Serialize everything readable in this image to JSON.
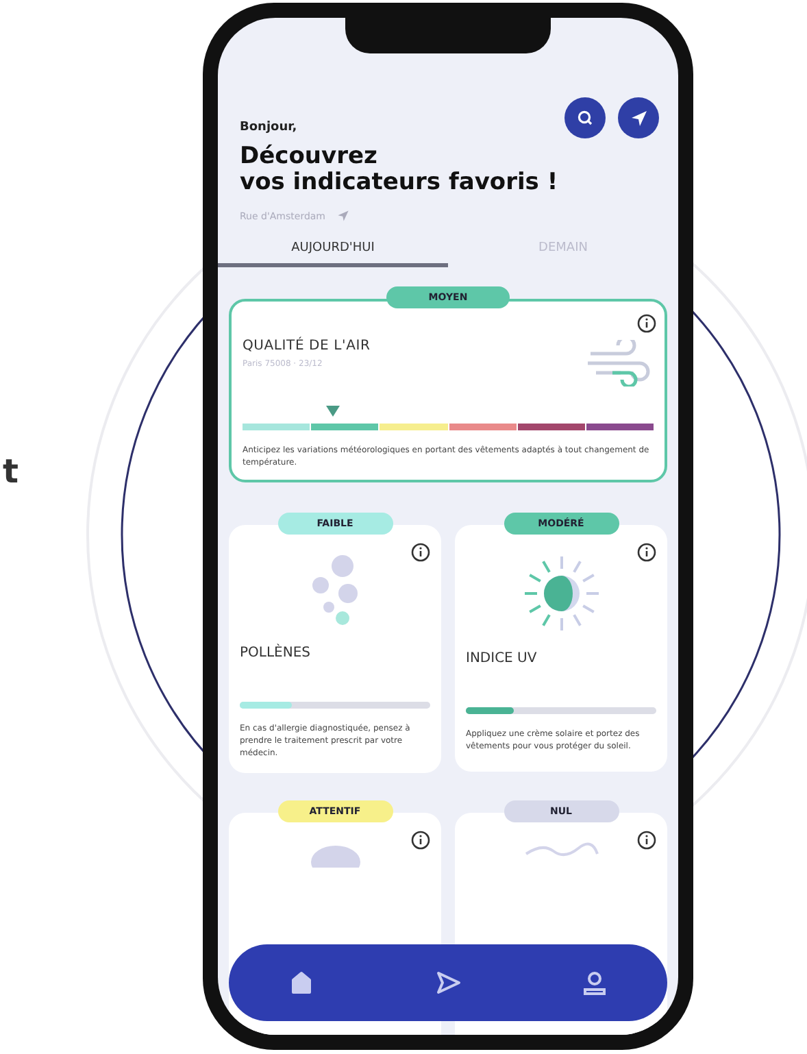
{
  "side_text": "t",
  "header": {
    "greeting": "Bonjour,",
    "title_line_1": "Découvrez",
    "title_line_2": "vos indicateurs favoris !",
    "location": "Rue d'Amsterdam"
  },
  "tabs": [
    {
      "label": "AUJOURD'HUI",
      "selected": true
    },
    {
      "label": "DEMAIN",
      "selected": false
    }
  ],
  "air_quality": {
    "badge": "MOYEN",
    "color": "#5ec7a8",
    "title": "QUALITÉ DE L'AIR",
    "subtitle": "Paris 75008 · 23/12",
    "level": 0.22,
    "description": "Anticipez les variations météorologiques en portant des vêtements adaptés à tout changement de température."
  },
  "indicators": [
    {
      "kind": "pollen",
      "badge": "FAIBLE",
      "color": "#a6ebe3",
      "title": "POLLÈNES",
      "level": 0.27,
      "description": "En cas d'allergie diagnostiquée, pensez à prendre le traitement prescrit par votre médecin."
    },
    {
      "kind": "uv",
      "badge": "MODÉRÉ",
      "color": "#5ec7a8",
      "title": "INDICE UV",
      "level": 0.25,
      "description": "Appliquez une crème solaire et portez des vêtements pour vous protéger du soleil."
    },
    {
      "kind": "cloud",
      "badge": "ATTENTIF",
      "color": "#f7f08a"
    },
    {
      "kind": "wave",
      "badge": "NUL",
      "color": "#d7d9ea"
    }
  ],
  "nav": [
    {
      "kind": "home"
    },
    {
      "kind": "send"
    },
    {
      "kind": "user"
    }
  ]
}
